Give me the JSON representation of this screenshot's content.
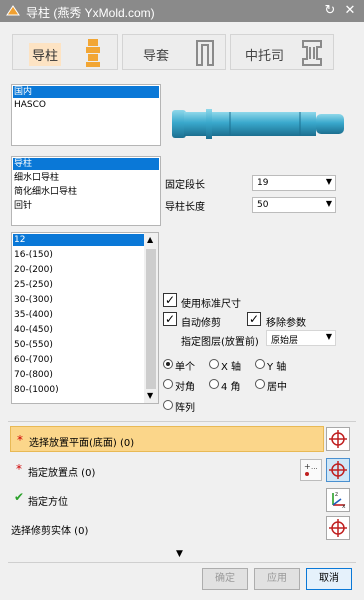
{
  "window": {
    "title": "导柱 (燕秀 YxMold.com)"
  },
  "tabs": [
    {
      "label": "导柱",
      "active": true
    },
    {
      "label": "导套",
      "active": false
    },
    {
      "label": "中托司",
      "active": false
    }
  ],
  "standard_list": [
    "国内",
    "HASCO"
  ],
  "type_list": [
    "导柱",
    "细水口导柱",
    "简化细水口导柱",
    "回针"
  ],
  "fixed_length": {
    "label": "固定段长",
    "value": "19"
  },
  "pillar_length": {
    "label": "导柱长度",
    "value": "50"
  },
  "size_list": [
    "12",
    "16-(150)",
    "20-(200)",
    "25-(250)",
    "30-(300)",
    "35-(400)",
    "40-(450)",
    "50-(550)",
    "60-(700)",
    "70-(800)",
    "80-(1000)"
  ],
  "options": {
    "use_standard": "使用标准尺寸",
    "auto_trim": "自动修剪",
    "remove_params": "移除参数",
    "layer_label": "指定图层(放置前)",
    "layer_value": "原始层"
  },
  "placement": {
    "single": "单个",
    "x_axis": "X 轴",
    "y_axis": "Y 轴",
    "diagonal": "对角",
    "four_corner": "4 角",
    "center": "居中",
    "array": "阵列"
  },
  "steps": [
    {
      "label": "选择放置平面(底面) (0)",
      "required": true
    },
    {
      "label": "指定放置点 (0)",
      "required": true
    },
    {
      "label": "指定方位",
      "required": false
    },
    {
      "label": "选择修剪实体 (0)",
      "required": false
    }
  ],
  "buttons": {
    "ok": "确定",
    "apply": "应用",
    "cancel": "取消"
  },
  "colors": {
    "accent": "#0a78d7",
    "highlight": "#fbd68a",
    "required": "#d00000",
    "done": "#2aa12a"
  }
}
